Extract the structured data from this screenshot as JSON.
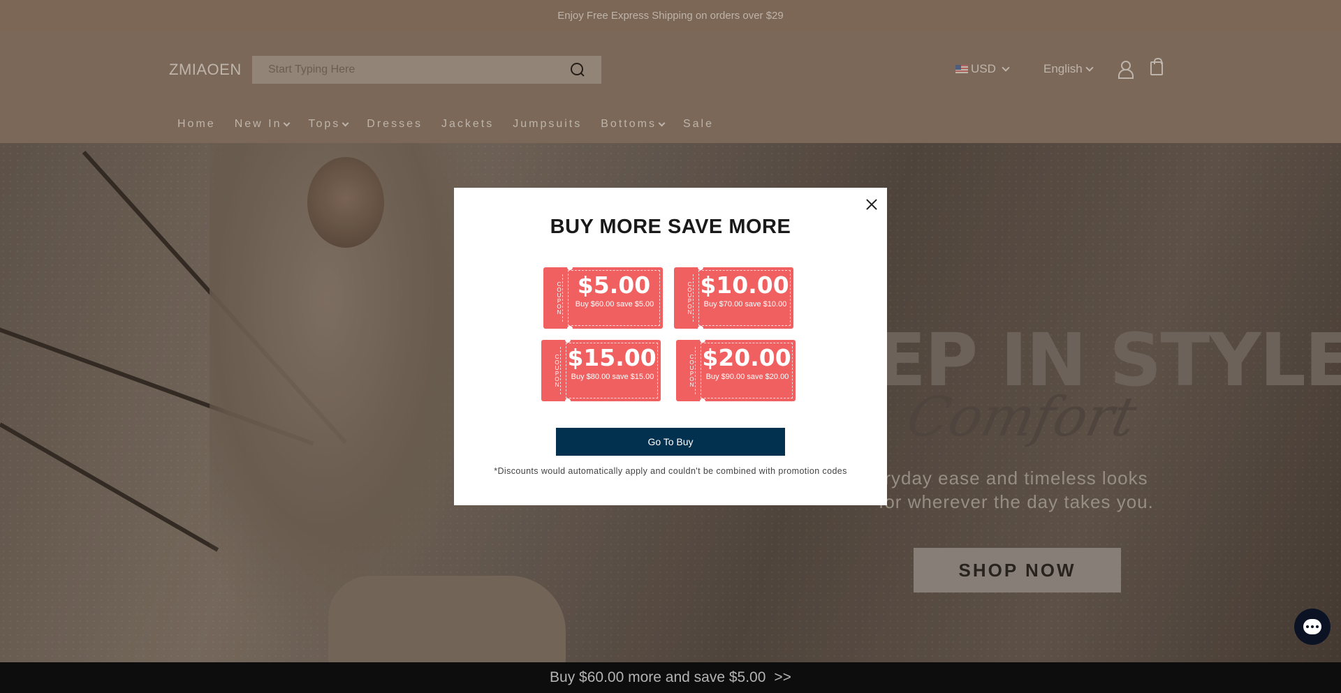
{
  "announcement": {
    "text": "Enjoy Free Express Shipping on orders over $29"
  },
  "header": {
    "logo": "ZMIAOEN",
    "search": {
      "placeholder": "Start Typing Here",
      "value": ""
    },
    "currency": {
      "label": "USD"
    },
    "language": {
      "label": "English"
    },
    "nav": [
      {
        "label": "Home",
        "has_dropdown": false
      },
      {
        "label": "New In",
        "has_dropdown": true
      },
      {
        "label": "Tops",
        "has_dropdown": true
      },
      {
        "label": "Dresses",
        "has_dropdown": false
      },
      {
        "label": "Jackets",
        "has_dropdown": false
      },
      {
        "label": "Jumpsuits",
        "has_dropdown": false
      },
      {
        "label": "Bottoms",
        "has_dropdown": true
      },
      {
        "label": "Sale",
        "has_dropdown": false
      }
    ]
  },
  "hero": {
    "title": "EP IN STYLE",
    "script": "Comfort",
    "subtitle_line1": "ryday ease and timeless looks",
    "subtitle_line2": "for wherever the day takes you.",
    "cta": "SHOP NOW"
  },
  "modal": {
    "title": "BUY MORE SAVE MORE",
    "coupon_tag": "COUPON",
    "coupons": [
      {
        "amount": "$5.00",
        "desc": "Buy $60.00 save $5.00"
      },
      {
        "amount": "$10.00",
        "desc": "Buy $70.00 save $10.00"
      },
      {
        "amount": "$15.00",
        "desc": "Buy $80.00 save $15.00"
      },
      {
        "amount": "$20.00",
        "desc": "Buy $90.00 save $20.00"
      }
    ],
    "button": "Go To Buy",
    "note": "*Discounts would automatically apply and couldn't be combined with promotion codes"
  },
  "bottom_bar": {
    "text": "Buy $60.00 more and save $5.00",
    "arrow": ">>"
  },
  "colors": {
    "coupon": "#f06060",
    "primary_button": "#02304f",
    "header_bg": "#8c7766",
    "bottom_bar_bg": "#0d0d0d"
  },
  "icons": [
    "search-icon",
    "chevron-down-icon",
    "flag-us-icon",
    "user-icon",
    "shopping-bag-icon",
    "close-icon",
    "chat-icon"
  ]
}
